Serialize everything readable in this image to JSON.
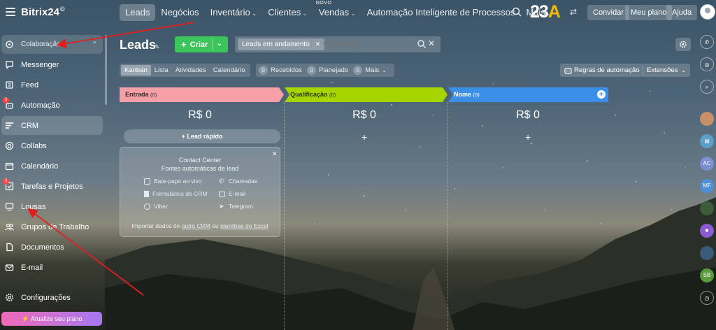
{
  "app": {
    "brand": "Bitrix24",
    "brand_mark": "©",
    "logo_digits": "23",
    "logo_letter": "A"
  },
  "topnav": {
    "items": [
      {
        "label": "Leads",
        "active": true,
        "chevron": false
      },
      {
        "label": "Negócios",
        "chevron": false
      },
      {
        "label": "Inventário",
        "chevron": true
      },
      {
        "label": "Clientes",
        "chevron": true
      },
      {
        "label": "Vendas",
        "chevron": true,
        "tag": "NOVO"
      },
      {
        "label": "Automação Inteligente de Processos",
        "chevron": false
      },
      {
        "label": "Mais",
        "chevron": true
      }
    ],
    "invite": "Convidar",
    "plan": "Meu plano",
    "help": "Ajuda"
  },
  "sidebar": {
    "group_label": "Colaboração",
    "items": [
      {
        "label": "Messenger",
        "icon": "chat-icon"
      },
      {
        "label": "Feed",
        "icon": "feed-icon"
      },
      {
        "label": "Automação",
        "icon": "automation-icon",
        "badge": "3"
      },
      {
        "label": "CRM",
        "icon": "crm-icon",
        "active": true
      },
      {
        "label": "Collabs",
        "icon": "collabs-icon"
      },
      {
        "label": "Calendário",
        "icon": "calendar-icon"
      },
      {
        "label": "Tarefas e Projetos",
        "icon": "tasks-icon",
        "badge": "3"
      },
      {
        "label": "Lousas",
        "icon": "whiteboard-icon"
      },
      {
        "label": "Grupos de Trabalho",
        "icon": "groups-icon"
      },
      {
        "label": "Documentos",
        "icon": "documents-icon"
      },
      {
        "label": "E-mail",
        "icon": "mail-icon"
      }
    ],
    "settings": "Configurações",
    "upgrade": "Atualize seu plano"
  },
  "toolbar": {
    "title": "Leads",
    "create": "Criar",
    "filter_chip": "Leads em andamento",
    "search_placeholder": "+ pesquisa",
    "views": [
      "Kanban",
      "Lista",
      "Atividades",
      "Calendário"
    ],
    "counters": [
      {
        "count": "0",
        "label": "Recebidos"
      },
      {
        "count": "0",
        "label": "Planejado"
      },
      {
        "count": "0",
        "label": "Mais"
      }
    ],
    "automation_rules": "Regras de automação",
    "extensions": "Extensões"
  },
  "kanban": {
    "columns": [
      {
        "name": "Entrada",
        "count": "(0)",
        "sum": "R$ 0",
        "color": "#f2888f"
      },
      {
        "name": "Qualificação",
        "count": "(0)",
        "sum": "R$ 0",
        "color": "#a6d500"
      },
      {
        "name": "Nome",
        "count": "(0)",
        "sum": "R$ 0",
        "color": "#3b8fe8"
      }
    ],
    "quick_lead": "Lead rápido"
  },
  "contact_center": {
    "title": "Contact Center",
    "subtitle": "Fontes automáticas de lead",
    "items": [
      "Bate-papo ao vivo",
      "Chamadas",
      "Formulários de CRM",
      "E-mail",
      "Viber",
      "Telegram"
    ],
    "footer_prefix": "Importar dados de",
    "footer_link1": "outro CRM",
    "footer_mid": "ou",
    "footer_link2": "planilhas do Excel"
  },
  "rail": {
    "initials": [
      "AC",
      "MF",
      "SB"
    ]
  },
  "colors": {
    "create_green": "#3bc55a",
    "annotation_red": "#e02020"
  }
}
